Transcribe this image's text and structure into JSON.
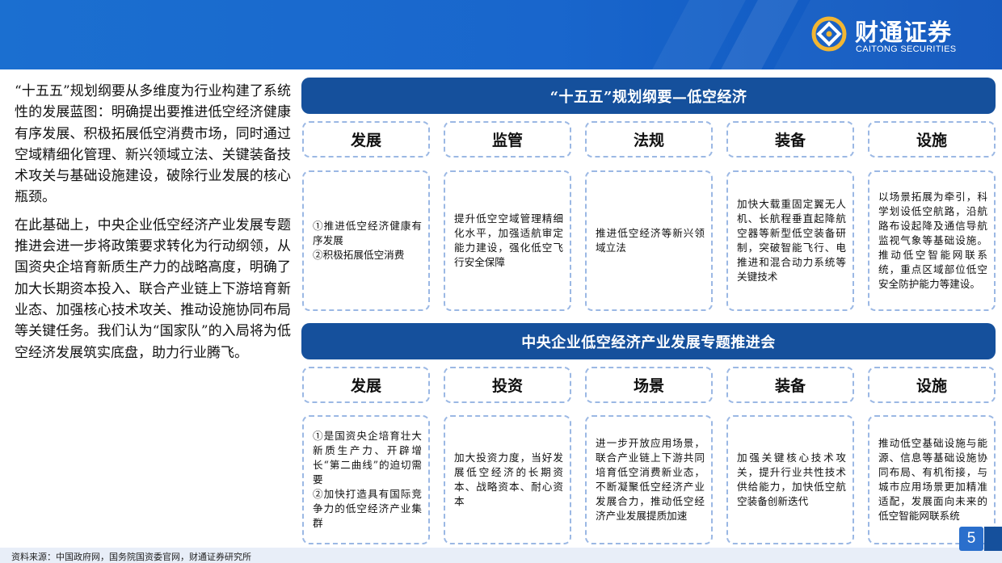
{
  "header": {
    "logo_cn": "财通证券",
    "logo_en": "CAITONG SECURITIES",
    "logo_icon": "caitong-logo-icon",
    "brand_color": "#1b6fd0"
  },
  "left_text": {
    "paragraph1": "“十五五”规划纲要从多维度为行业构建了系统性的发展蓝图：明确提出要推进低空经济健康有序发展、积极拓展低空消费市场，同时通过空域精细化管理、新兴领域立法、关键装备技术攻关与基础设施建设，破除行业发展的核心瓶颈。",
    "paragraph2": "在此基础上，中央企业低空经济产业发展专题推进会进一步将政策要求转化为行动纲领，从国资央企培育新质生产力的战略高度，明确了加大长期资本投入、联合产业链上下游培育新业态、加强核心技术攻关、推动设施协同布局等关键任务。我们认为“国家队”的入局将为低空经济发展筑实底盘，助力行业腾飞。"
  },
  "section1": {
    "title": "“十五五”规划纲要—低空经济",
    "headers": [
      "发展",
      "监管",
      "法规",
      "装备",
      "设施"
    ],
    "contents": [
      "①推进低空经济健康有序发展\n②积极拓展低空消费",
      "提升低空空域管理精细化水平，加强适航审定能力建设，强化低空飞行安全保障",
      "推进低空经济等新兴领域立法",
      "加快大载重固定翼无人机、长航程垂直起降航空器等新型低空装备研制，突破智能飞行、电推进和混合动力系统等关键技术",
      "以场景拓展为牵引，科学划设低空航路，沿航路布设起降及通信导航监视气象等基础设施。推动低空智能网联系统，重点区域部位低空安全防护能力等建设。"
    ]
  },
  "section2": {
    "title": "中央企业低空经济产业发展专题推进会",
    "headers": [
      "发展",
      "投资",
      "场景",
      "装备",
      "设施"
    ],
    "contents": [
      "①是国资央企培育壮大新质生产力、开辟增长“第二曲线”的迫切需要\n②加快打造具有国际竞争力的低空经济产业集群",
      "加大投资力度，当好发展低空经济的长期资本、战略资本、耐心资本",
      "进一步开放应用场景，联合产业链上下游共同培育低空消费新业态，不断凝聚低空经济产业发展合力，推动低空经济产业发展提质加速",
      "加强关键核心技术攻关，提升行业共性技术供给能力，加快低空航空装备创新迭代",
      "推动低空基础设施与能源、信息等基础设施协同布局、有机衔接，与城市应用场景更加精准适配，发展面向未来的低空智能网联系统"
    ]
  },
  "footer": {
    "source": "资料来源：中国政府网，国务院国资委官网，财通证券研究所",
    "page_number": "5"
  }
}
